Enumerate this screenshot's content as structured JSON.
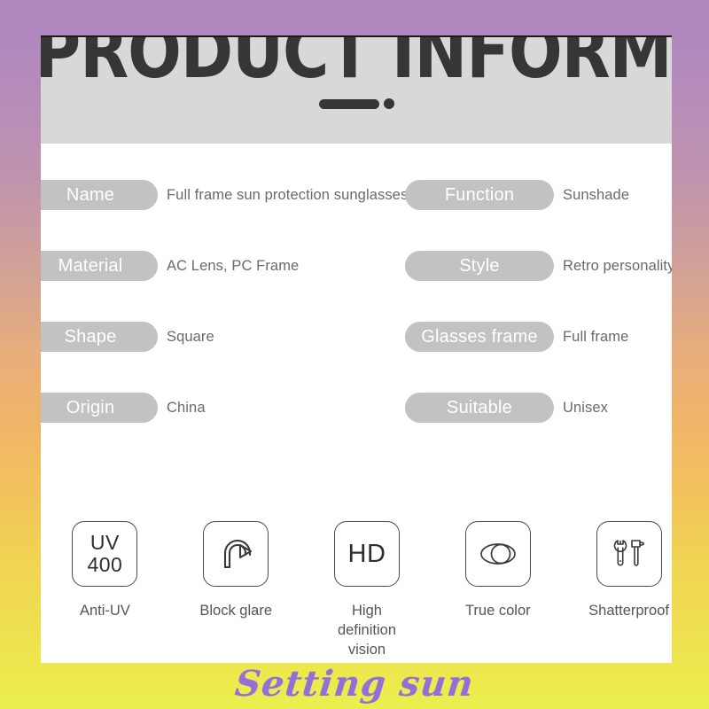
{
  "header": {
    "title": "PRODUCT INFORMATION",
    "divider": {
      "dash": "dash-bar",
      "dot": "dot"
    }
  },
  "specs": {
    "rows": [
      {
        "left": {
          "label": "Name",
          "value": "Full frame sun protection sunglasses"
        },
        "right": {
          "label": "Function",
          "value": "Sunshade"
        }
      },
      {
        "left": {
          "label": "Material",
          "value": "AC Lens, PC Frame"
        },
        "right": {
          "label": "Style",
          "value": "Retro personality"
        }
      },
      {
        "left": {
          "label": "Shape",
          "value": "Square"
        },
        "right": {
          "label": "Glasses frame",
          "value": "Full frame"
        }
      },
      {
        "left": {
          "label": "Origin",
          "value": "China"
        },
        "right": {
          "label": "Suitable",
          "value": "Unisex"
        }
      }
    ]
  },
  "features": [
    {
      "icon": "uv400-icon",
      "icon_text": "UV\n400",
      "label": "Anti-UV"
    },
    {
      "icon": "u-turn-arrow-icon",
      "icon_text": "",
      "label": "Block glare"
    },
    {
      "icon": "hd-icon",
      "icon_text": "HD",
      "label": "High definition\nvision"
    },
    {
      "icon": "lens-overlap-icon",
      "icon_text": "",
      "label": "True color"
    },
    {
      "icon": "wrench-hammer-icon",
      "icon_text": "",
      "label": "Shatterproof"
    }
  ],
  "watermark": {
    "text": "Setting sun"
  },
  "colors": {
    "gradient_top": "#ae87bf",
    "gradient_mid": "#f0b567",
    "gradient_bottom": "#ecef4e",
    "card": "#ffffff",
    "header_band": "#d8d8d8",
    "pill": "#c2c2c2",
    "pill_text": "#ffffff",
    "value_text": "#6a6a6a",
    "title_text": "#363636",
    "icon_stroke": "#4a4a4a",
    "watermark_text": "#9370d8"
  }
}
